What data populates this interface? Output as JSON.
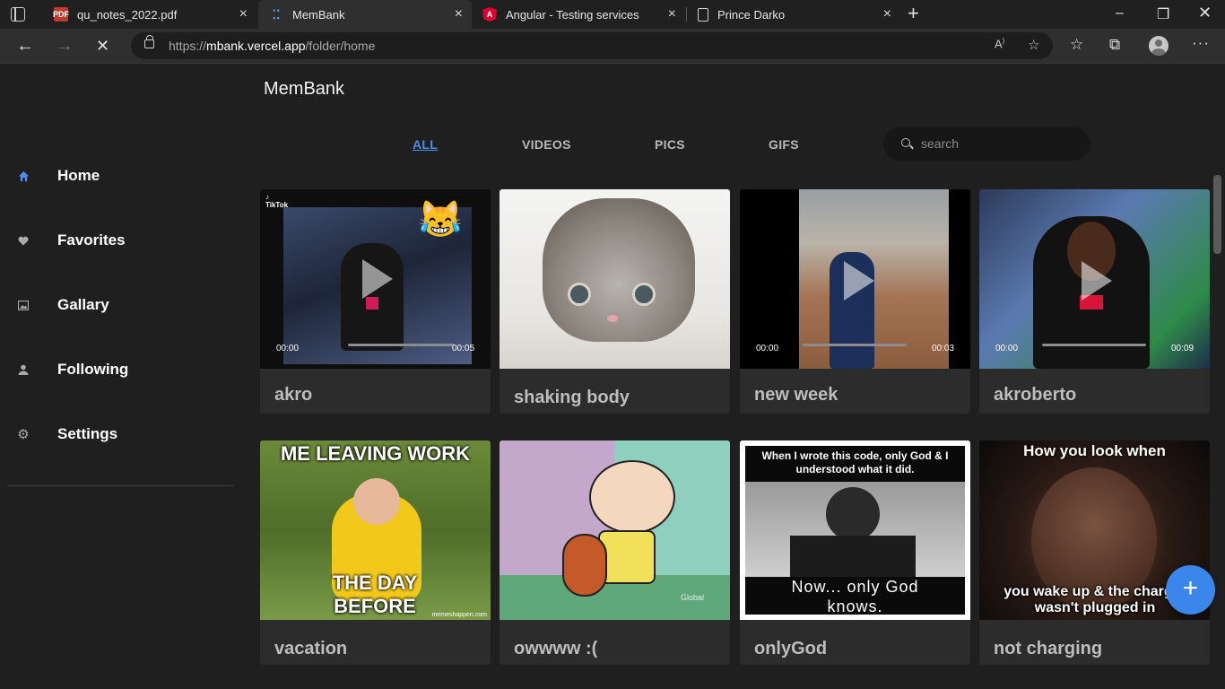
{
  "browser": {
    "tabs": [
      {
        "title": "qu_notes_2022.pdf",
        "favicon": "pdf-icon",
        "active": false
      },
      {
        "title": "MemBank",
        "favicon": "membank-favicon",
        "active": true
      },
      {
        "title": "Angular - Testing services",
        "favicon": "angular-icon",
        "active": false
      },
      {
        "title": "Prince Darko",
        "favicon": "document-icon",
        "active": false
      }
    ],
    "url_prefix": "https://",
    "url_host": "mbank.vercel.app",
    "url_path": "/folder/home"
  },
  "app": {
    "brand": "MemBank"
  },
  "sidebar": {
    "items": [
      {
        "label": "Home",
        "icon": "home-icon",
        "active": true
      },
      {
        "label": "Favorites",
        "icon": "heart-icon",
        "active": false
      },
      {
        "label": "Gallary",
        "icon": "image-icon",
        "active": false
      },
      {
        "label": "Following",
        "icon": "person-icon",
        "active": false
      },
      {
        "label": "Settings",
        "icon": "gear-icon",
        "active": false
      }
    ]
  },
  "filters": {
    "tabs": [
      "ALL",
      "VIDEOS",
      "PICS",
      "GIFS"
    ],
    "active": "ALL",
    "search_placeholder": "search"
  },
  "memes": [
    {
      "title": "akro",
      "type": "video",
      "time_current": "00:00",
      "time_total": "00:05",
      "progress": 0.0
    },
    {
      "title": "shaking body",
      "type": "gif"
    },
    {
      "title": "new week",
      "type": "video",
      "time_current": "00:00",
      "time_total": "00:03",
      "progress": 0.0
    },
    {
      "title": "akroberto",
      "type": "video",
      "time_current": "00:00",
      "time_total": "00:09",
      "progress": 0.0
    },
    {
      "title": "vacation",
      "type": "pic",
      "caption_top": "ME LEAVING WORK",
      "caption_bottom": "THE DAY BEFORE VACATION",
      "watermark": "memeshappen.com"
    },
    {
      "title": "owwww :(",
      "type": "gif"
    },
    {
      "title": "onlyGod",
      "type": "pic",
      "caption_top": "When I wrote this code, only God & I understood what it did.",
      "caption_bottom": "Now... only God knows."
    },
    {
      "title": "not charging",
      "type": "pic",
      "caption_top": "How you look when",
      "caption_bottom": "you wake up & the charger wasn't plugged in"
    }
  ],
  "colors": {
    "accent": "#3a86ea",
    "background": "#1f1f1f",
    "card": "#2c2c2c"
  }
}
